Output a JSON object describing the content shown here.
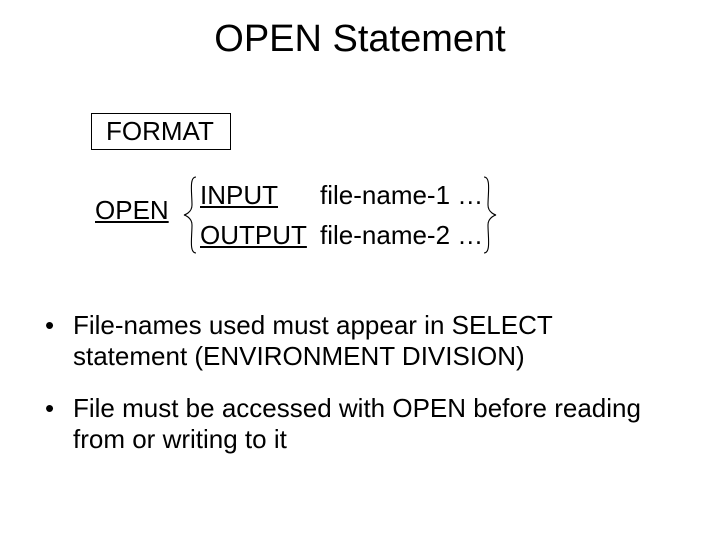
{
  "title": "OPEN Statement",
  "format_label": "FORMAT",
  "syntax": {
    "keyword": "OPEN",
    "lines": [
      {
        "mode": "INPUT",
        "operand": "file-name-1 …"
      },
      {
        "mode": "OUTPUT",
        "operand": "file-name-2 …"
      }
    ]
  },
  "bullets": [
    "File-names used must appear in SELECT statement (ENVIRONMENT DIVISION)",
    "File must be accessed with OPEN before reading from or writing to it"
  ]
}
